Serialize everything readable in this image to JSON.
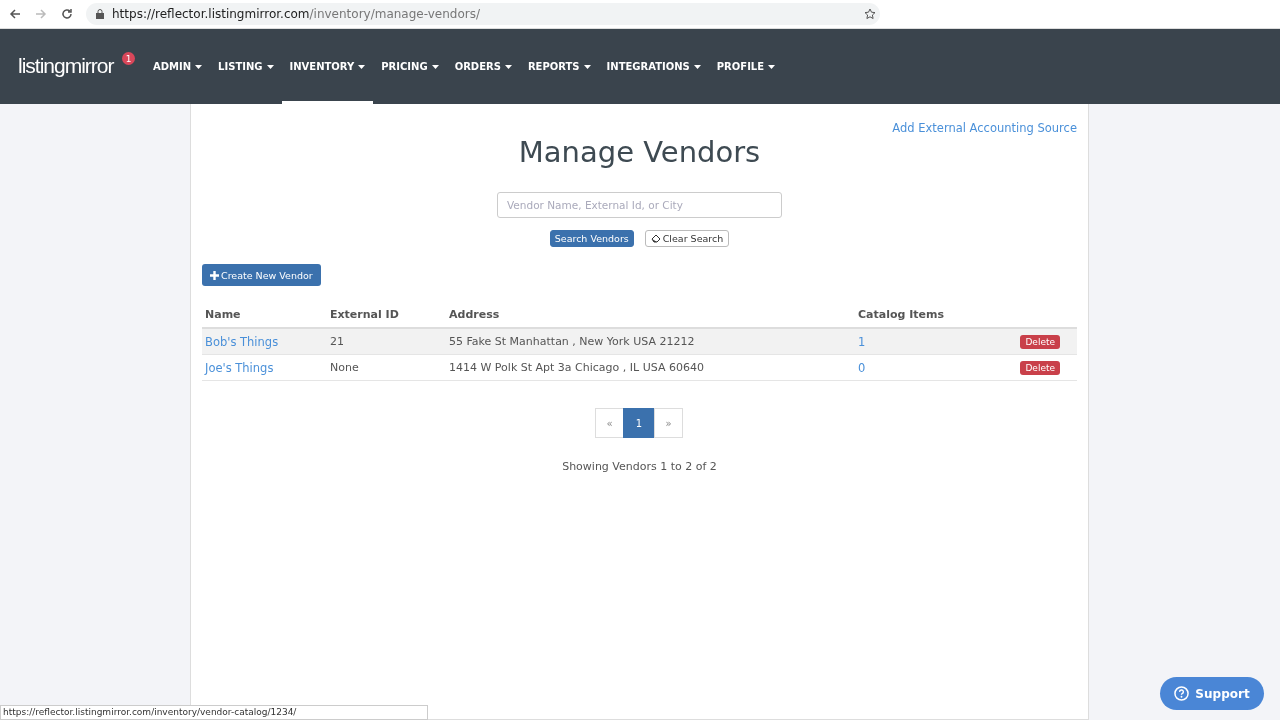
{
  "browser": {
    "url_host": "https://reflector.listingmirror.com",
    "url_path": "/inventory/manage-vendors/"
  },
  "navbar": {
    "logo": "listingmirror",
    "logo_badge": "1",
    "menu": [
      {
        "label": "ADMIN",
        "selected": false
      },
      {
        "label": "LISTING",
        "selected": false
      },
      {
        "label": "INVENTORY",
        "selected": true
      },
      {
        "label": "PRICING",
        "selected": false
      },
      {
        "label": "ORDERS",
        "selected": false
      },
      {
        "label": "REPORTS",
        "selected": false
      },
      {
        "label": "INTEGRATIONS",
        "selected": false
      },
      {
        "label": "PROFILE",
        "selected": false
      }
    ]
  },
  "page": {
    "top_link": "Add External Accounting Source",
    "title": "Manage Vendors",
    "search": {
      "placeholder": "Vendor Name, External Id, or City"
    },
    "search_button": "Search Vendors",
    "clear_button": "Clear Search",
    "create_button": "Create New Vendor",
    "table": {
      "columns": [
        "Name",
        "External ID",
        "Address",
        "Catalog Items"
      ],
      "rows": [
        {
          "name": "Bob's Things",
          "external_id": "21",
          "address": "55 Fake St Manhattan , New York USA 21212",
          "catalog_items": "1",
          "action": "Delete",
          "hovered": true
        },
        {
          "name": "Joe's Things",
          "external_id": "None",
          "address": "1414 W Polk St Apt 3a Chicago , IL USA 60640",
          "catalog_items": "0",
          "action": "Delete",
          "hovered": false
        }
      ]
    },
    "pagination": {
      "prev": "«",
      "pages": [
        {
          "label": "1",
          "selected": true
        }
      ],
      "next": "»"
    },
    "summary": "Showing Vendors 1 to 2 of 2"
  },
  "status_url": "https://reflector.listingmirror.com/inventory/vendor-catalog/1234/",
  "support_button": "Support"
}
